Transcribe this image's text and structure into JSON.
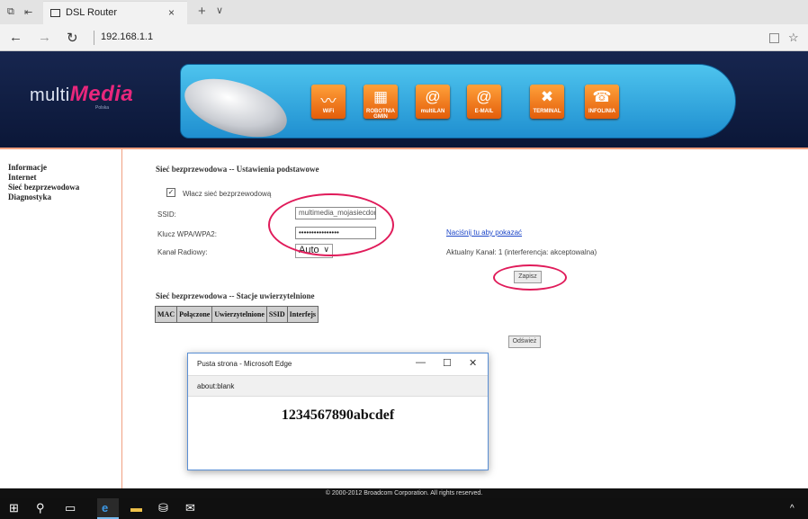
{
  "browser": {
    "tab_title": "DSL Router",
    "tab_close": "×",
    "new_tab": "+",
    "tab_menu": "∨",
    "back": "←",
    "forward": "→",
    "refresh": "↻",
    "url": "192.168.1.1",
    "favorite": "☆"
  },
  "header": {
    "logo_prefix": "multi",
    "logo_emphasis": "Media",
    "logo_sub": "Polska",
    "icons": [
      {
        "label": "WiFi",
        "glyph": "wifi-icon"
      },
      {
        "label": "ROBOTNIA GMIN",
        "glyph": "building-icon"
      },
      {
        "label": "multiLAN",
        "glyph": "at-icon"
      },
      {
        "label": "E-MAIL",
        "glyph": "email-icon"
      },
      {
        "label": "TERMINAL",
        "glyph": "tools-icon"
      },
      {
        "label": "INFOLINIA",
        "glyph": "phone-icon"
      }
    ]
  },
  "sidebar": {
    "items": [
      "Informacje",
      "Internet",
      "Sieć bezprzewodowa",
      "Diagnostyka"
    ]
  },
  "basic": {
    "title": "Sieć bezprzewodowa -- Ustawienia podstawowe",
    "enable_checkbox_mark": "✓",
    "enable_label": "Włacz sieć bezprzewodową",
    "ssid_label": "SSID:",
    "ssid_value": "multimedia_mojasiecdom",
    "key_label": "Klucz WPA/WPA2:",
    "key_value": "••••••••••••••••",
    "show_link": "Naciśnij tu aby pokazać",
    "channel_label": "Kanał Radiowy:",
    "channel_value": "Auto",
    "current_channel": "Aktualny Kanał: 1 (interferencja: akceptowalna)",
    "save_button": "Zapisz"
  },
  "stations": {
    "title": "Sieć bezprzewodowa -- Stacje uwierzytelnione",
    "columns": [
      "MAC",
      "Połączone",
      "Uwierzytelnione",
      "SSID",
      "Interfejs"
    ],
    "refresh_button": "Odśwież"
  },
  "footer": {
    "text": "© 2000-2012 Broadcom Corporation. All rights reserved."
  },
  "popup": {
    "title": "Pusta strona - Microsoft Edge",
    "minimize": "—",
    "maximize": "☐",
    "close": "✕",
    "address": "about:blank",
    "body_text": "1234567890abcdef"
  },
  "colors": {
    "header_bg": "#17264f",
    "banner": "#2aa7e0",
    "accent_orange": "#f0a080",
    "highlight_ring": "#e01b5a",
    "link": "#1c46c8"
  }
}
